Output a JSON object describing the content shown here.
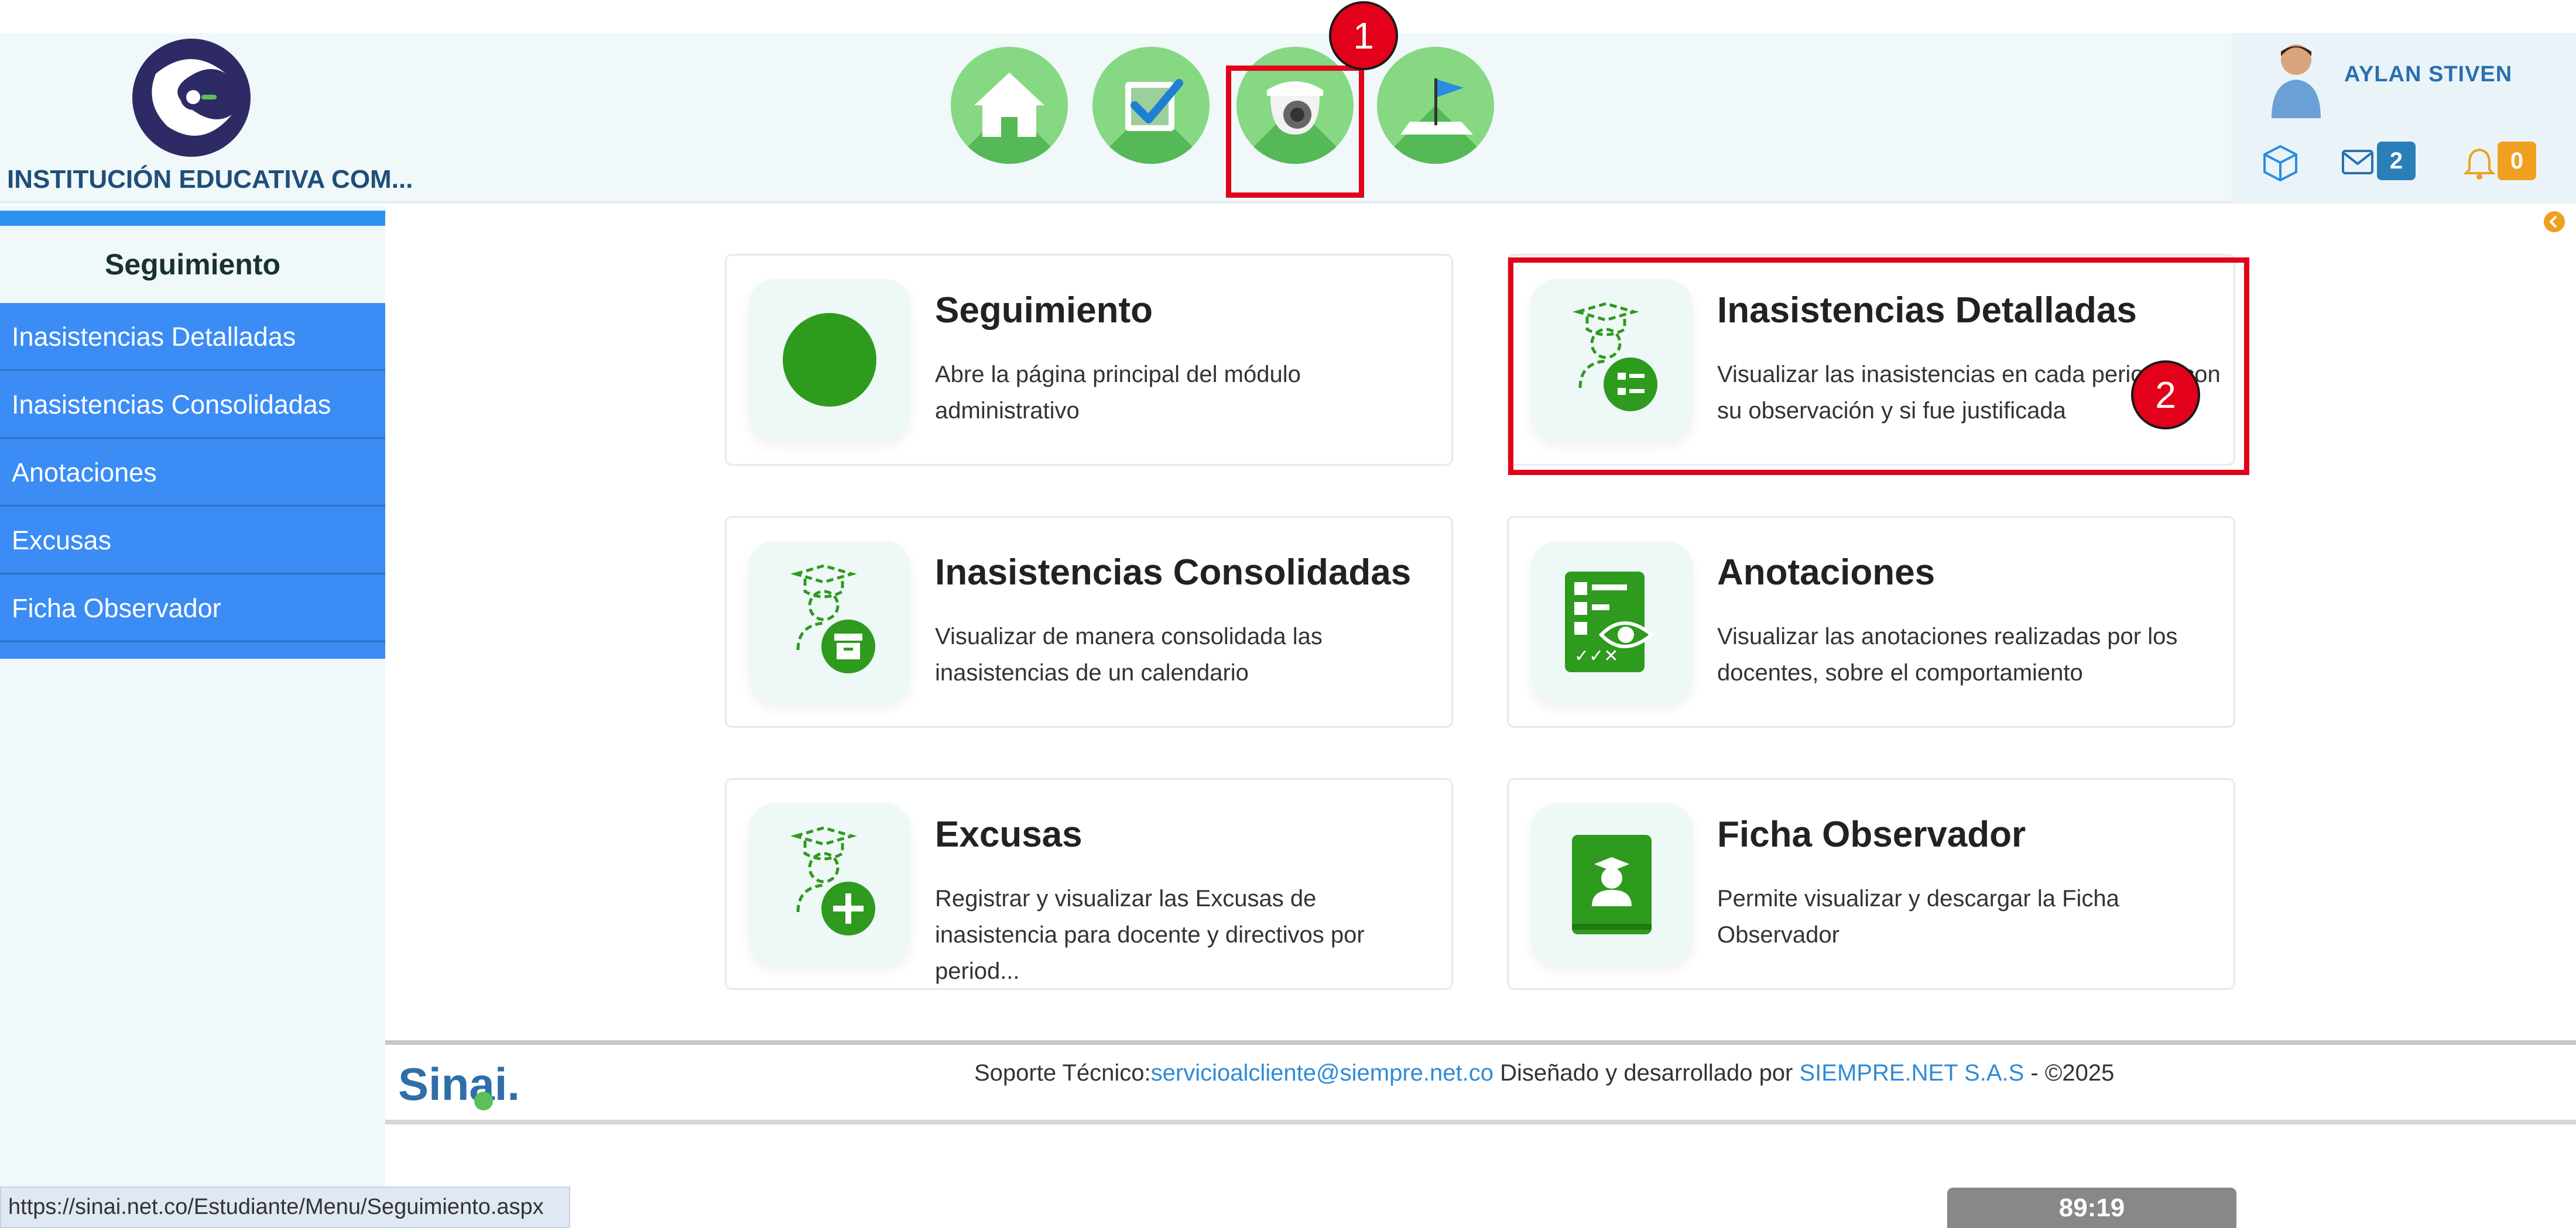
{
  "header": {
    "school_name": "INSTITUCIÓN EDUCATIVA COM...",
    "nav": [
      {
        "name": "home-icon"
      },
      {
        "name": "checkbox-icon"
      },
      {
        "name": "camera-icon"
      },
      {
        "name": "flag-icon"
      }
    ],
    "markers": {
      "one": "1",
      "two": "2"
    }
  },
  "user": {
    "name": "AYLAN STIVEN",
    "messages_count": "2",
    "notifications_count": "0"
  },
  "sidebar": {
    "title": "Seguimiento",
    "items": [
      {
        "label": "Inasistencias Detalladas"
      },
      {
        "label": "Inasistencias Consolidadas"
      },
      {
        "label": "Anotaciones"
      },
      {
        "label": "Excusas"
      },
      {
        "label": "Ficha Observador"
      }
    ]
  },
  "cards": [
    {
      "title": "Seguimiento",
      "desc": "Abre la página principal del módulo administrativo",
      "icon": "green-circle-icon"
    },
    {
      "title": "Inasistencias Detalladas",
      "desc": "Visualizar las inasistencias en cada periodo, con su observación y si fue justificada",
      "icon": "student-list-icon"
    },
    {
      "title": "Inasistencias Consolidadas",
      "desc": "Visualizar de manera consolidada las inasistencias de un calendario",
      "icon": "student-archive-icon"
    },
    {
      "title": "Anotaciones",
      "desc": "Visualizar las anotaciones realizadas por los docentes, sobre el comportamiento",
      "icon": "checklist-eye-icon"
    },
    {
      "title": "Excusas",
      "desc": "Registrar y visualizar las Excusas de inasistencia para docente y directivos por period...",
      "icon": "student-add-icon"
    },
    {
      "title": "Ficha Observador",
      "desc": "Permite visualizar y descargar la Ficha Observador",
      "icon": "graduate-book-icon"
    }
  ],
  "footer": {
    "logo_text": "Sinai.",
    "support_label": "Soporte Técnico:",
    "support_email": "servicioalcliente@siempre.net.co",
    "designed_by": " Diseñado y desarrollado por ",
    "company": "SIEMPRE.NET S.A.S",
    "copyright": " -  ©2025"
  },
  "status": {
    "url": "https://sinai.net.co/Estudiante/Menu/Seguimiento.aspx",
    "timer": "89:19"
  },
  "colors": {
    "accent_blue": "#3b8cf5",
    "brand_green": "#2e9a1e",
    "highlight_red": "#e3001b"
  }
}
